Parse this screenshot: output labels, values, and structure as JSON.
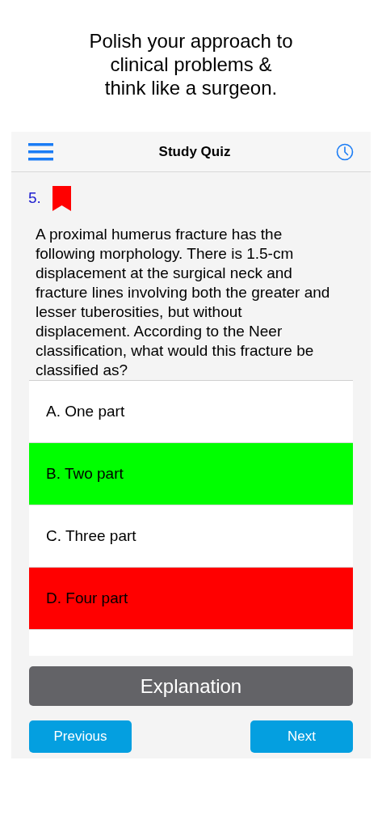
{
  "headline": [
    "Polish your approach to",
    "clinical problems &",
    "think like a surgeon."
  ],
  "nav": {
    "title": "Study Quiz"
  },
  "question": {
    "number": "5.",
    "bookmarked": true,
    "text": "A proximal humerus fracture has the following morphology. There is 1.5-cm displacement at the surgical neck and fracture lines involving both the greater and lesser tuberosities, but without displacement. According to the Neer classification, what would this fracture be classified as?"
  },
  "answers": [
    {
      "label": "A. One part",
      "color": "#ffffff"
    },
    {
      "label": "B. Two part",
      "color": "#00ff00"
    },
    {
      "label": "C. Three part",
      "color": "#ffffff"
    },
    {
      "label": "D. Four part",
      "color": "#ff0000"
    }
  ],
  "buttons": {
    "explanation": "Explanation",
    "previous": "Previous",
    "next": "Next"
  }
}
